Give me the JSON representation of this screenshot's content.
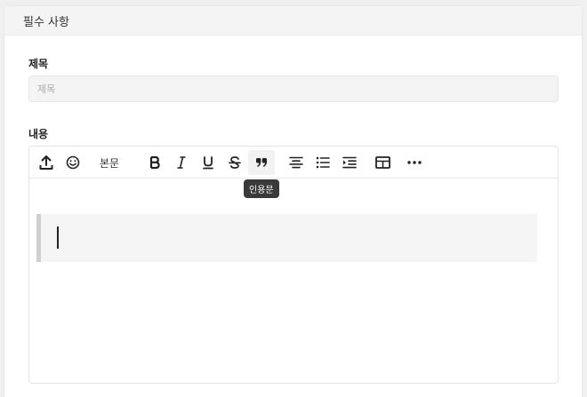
{
  "panel": {
    "title": "필수 사항"
  },
  "title_field": {
    "label": "제목",
    "placeholder": "제목",
    "value": ""
  },
  "content_field": {
    "label": "내용"
  },
  "toolbar": {
    "paragraph_label": "본문",
    "tooltip": "인용문",
    "active_tool": "blockquote"
  },
  "icons": [
    "upload-icon",
    "emoji-icon",
    "bold-icon",
    "italic-icon",
    "underline-icon",
    "strikethrough-icon",
    "quote-icon",
    "align-center-icon",
    "bullet-list-icon",
    "indent-icon",
    "table-icon",
    "more-icon"
  ],
  "colors": {
    "quote_bar": "#cfcfcf",
    "tooltip_bg": "#3a3a3a",
    "header_bg": "#f4f4f4"
  }
}
